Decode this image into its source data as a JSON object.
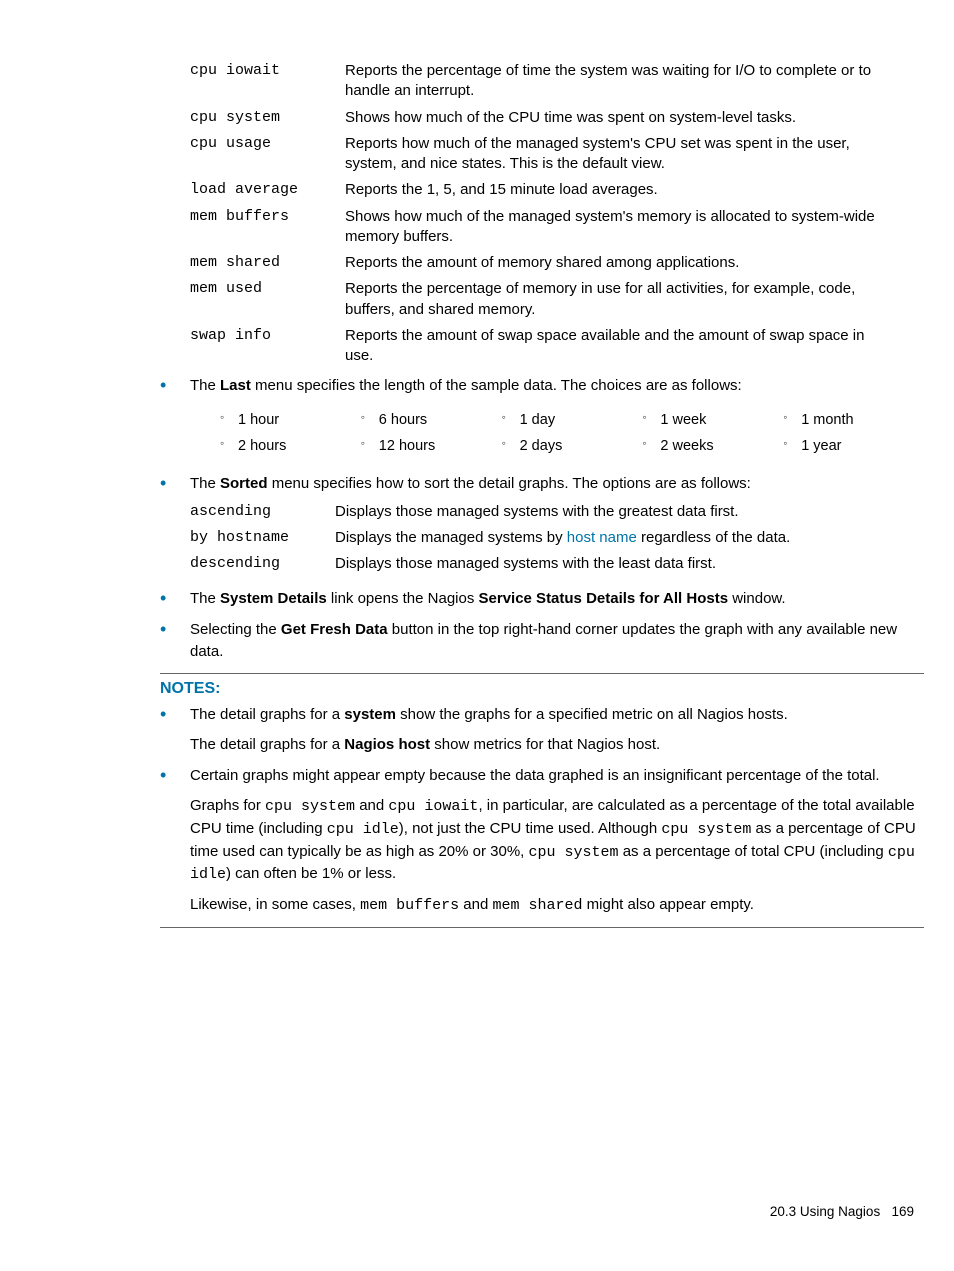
{
  "defs1": [
    {
      "term": "cpu iowait",
      "desc": "Reports the percentage of time the system was waiting for I/O to complete or to handle an interrupt."
    },
    {
      "term": "cpu system",
      "desc": "Shows how much of the CPU time was spent on system-level tasks."
    },
    {
      "term": "cpu usage",
      "desc": "Reports how much of the managed system's CPU set was spent in the user, system, and nice states. This is the default view."
    },
    {
      "term": "load average",
      "desc": "Reports the 1, 5, and 15 minute load averages."
    },
    {
      "term": "mem buffers",
      "desc": "Shows how much of the managed system's memory is allocated to system-wide memory buffers."
    },
    {
      "term": "mem shared",
      "desc": "Reports the amount of memory shared among applications."
    },
    {
      "term": "mem used",
      "desc": "Reports the percentage of memory in use for all activities, for example, code, buffers, and shared memory."
    },
    {
      "term": "swap info",
      "desc": "Reports the amount of swap space available and the amount of swap space in use."
    }
  ],
  "last_menu": {
    "pre": "The ",
    "bold": "Last",
    "post": " menu specifies the length of the sample data. The choices are as follows:",
    "cols": [
      [
        "1 hour",
        "2 hours"
      ],
      [
        "6 hours",
        "12 hours"
      ],
      [
        "1 day",
        "2 days"
      ],
      [
        "1 week",
        "2 weeks"
      ],
      [
        "1 month",
        "1 year"
      ]
    ]
  },
  "sorted_menu": {
    "pre": "The ",
    "bold": "Sorted",
    "post": " menu specifies how to sort the detail graphs. The options are as follows:",
    "rows": [
      {
        "term": "ascending",
        "desc_pre": "Displays those managed systems with the greatest data first.",
        "link": "",
        "desc_post": ""
      },
      {
        "term": "by hostname",
        "desc_pre": "Displays the managed systems by ",
        "link": "host name",
        "desc_post": " regardless of the data."
      },
      {
        "term": "descending",
        "desc_pre": "Displays those managed systems with the least data first.",
        "link": "",
        "desc_post": ""
      }
    ]
  },
  "sysdetails": {
    "t1": "The ",
    "b1": "System Details",
    "t2": " link opens the Nagios ",
    "b2": "Service Status Details for All Hosts",
    "t3": " window."
  },
  "freshdata": {
    "t1": "Selecting the ",
    "b1": "Get Fresh Data",
    "t2": " button in the top right-hand corner updates the graph with any available new data."
  },
  "notes_heading": "NOTES:",
  "note1": {
    "line1_pre": "The detail graphs for a ",
    "line1_bold": "system",
    "line1_post": " show the graphs for a specified metric on all Nagios hosts.",
    "line2_pre": "The detail graphs for a ",
    "line2_bold": "Nagios host",
    "line2_post": " show metrics for that Nagios host."
  },
  "note2": {
    "p1": "Certain graphs might appear empty because the data graphed is an insignificant percentage of the total.",
    "p2_1": "Graphs for ",
    "p2_m1": "cpu system",
    "p2_2": " and ",
    "p2_m2": "cpu iowait",
    "p2_3": ", in particular, are calculated as a percentage of the total available CPU time (including ",
    "p2_m3": "cpu idle",
    "p2_4": "), not just the CPU time used. Although ",
    "p2_m4": "cpu system",
    "p2_5": " as a percentage of CPU time used can typically be as high as 20% or 30%, ",
    "p2_m5": "cpu system",
    "p2_6": " as a percentage of total CPU (including ",
    "p2_m6": "cpu idle",
    "p2_7": ") can often be 1% or less.",
    "p3_1": "Likewise, in some cases, ",
    "p3_m1": "mem buffers",
    "p3_2": " and ",
    "p3_m2": "mem shared",
    "p3_3": " might also appear empty."
  },
  "footer": {
    "section": "20.3 Using Nagios",
    "page": "169"
  }
}
